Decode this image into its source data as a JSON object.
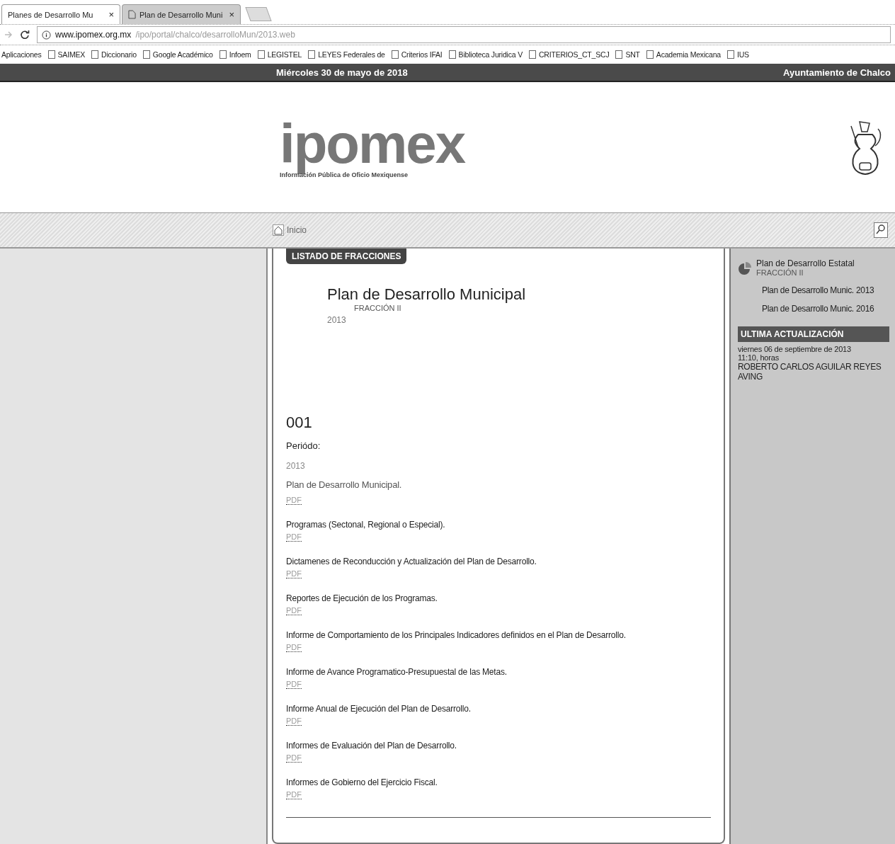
{
  "browser": {
    "tabs": [
      {
        "label": "Planes de Desarrollo Mu",
        "close": "×",
        "selected": true
      },
      {
        "label": "Plan de Desarrollo Muni",
        "close": "×",
        "selected": false
      }
    ],
    "url": {
      "host": "www.ipomex.org.mx",
      "path": "/ipo/portal/chalco/desarrolloMun/2013.web"
    },
    "bookmarks": [
      "Aplicaciones",
      "SAIMEX",
      "Diccionario",
      "Google Académico",
      "Infoem",
      "LEGISTEL",
      "LEYES Federales de",
      "Criterios IFAI",
      "Biblioteca Juridica V",
      "CRITERIOS_CT_SCJ",
      "SNT",
      "Academia Mexicana",
      "IUS"
    ]
  },
  "top_bar": {
    "date": "Miércoles 30 de mayo de 2018",
    "organization": "Ayuntamiento de Chalco"
  },
  "header": {
    "logo": "ipomex",
    "logo_subtitle": "Información Pública de Oficio Mexiquense"
  },
  "nav": {
    "home": "Inicio"
  },
  "card": {
    "tab": "LISTADO DE FRACCIONES",
    "title": "Plan de Desarrollo Municipal",
    "fraction": "FRACCIÓN II",
    "year": "2013",
    "number": "001",
    "period_label": "Periódo:",
    "period": "2013",
    "documents": [
      {
        "title": "Plan de Desarrollo Municipal.",
        "link": "PDF"
      },
      {
        "title": "Programas (Sectonal, Regional o Especial).",
        "link": "PDF"
      },
      {
        "title": "Dictamenes de Reconducción y Actualización del Plan de Desarrollo.",
        "link": "PDF"
      },
      {
        "title": "Reportes de Ejecución de los Programas.",
        "link": "PDF"
      },
      {
        "title": "Informe de Comportamiento de los Principales Indicadores definidos en el Plan de Desarrollo.",
        "link": "PDF"
      },
      {
        "title": "Informe de Avance Programatico-Presupuestal de las Metas.",
        "link": "PDF"
      },
      {
        "title": "Informe Anual de Ejecución del Plan de Desarrollo.",
        "link": "PDF"
      },
      {
        "title": "Informes de Evaluación del Plan de Desarrollo.",
        "link": "PDF"
      },
      {
        "title": "Informes de Gobierno del Ejercicio Fiscal.",
        "link": "PDF"
      }
    ]
  },
  "sidebar": {
    "heading": "Plan de Desarrollo Estatal",
    "fraction": "FRACCIÓN II",
    "links": [
      "Plan de Desarrollo Munic. 2013",
      "Plan de Desarrollo Munic. 2016"
    ],
    "update_heading": "ULTIMA ACTUALIZACIÓN",
    "update_date": "viernes 06 de septiembre de 2013",
    "update_time": "11:10, horas",
    "update_author": "ROBERTO CARLOS AGUILAR REYES AVING"
  }
}
